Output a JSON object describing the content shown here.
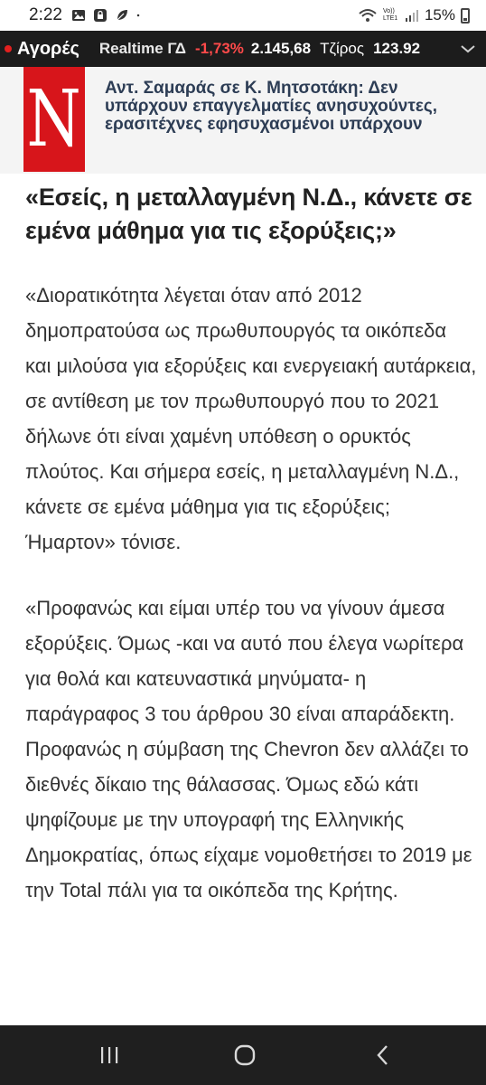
{
  "status_bar": {
    "time": "2:22",
    "network_label": "Vo)) LTE1",
    "battery": "15%"
  },
  "ticker": {
    "markets_label": "Αγορές",
    "realtime_label": "Realtime ΓΔ",
    "change": "-1,73%",
    "index_value": "2.145,68",
    "turnover_label": "Τζίρος",
    "turnover_value": "123.92"
  },
  "header": {
    "logo_letter": "N",
    "title": "Αντ. Σαμαράς σε Κ. Μητσοτάκη: Δεν υπάρχουν επαγγελματίες ανησυχούντες, ερασιτέχνες εφησυχασμένοι υπάρχουν"
  },
  "article": {
    "heading": "«Εσείς, η μεταλλαγμένη Ν.Δ., κάνετε σε εμένα μάθημα για τις εξορύξεις;»",
    "paragraph1": "«Διορατικότητα λέγεται όταν από 2012 δημοπρατούσα ως πρωθυπουργός τα οικόπεδα και μιλούσα για εξορύξεις και ενεργειακή αυτάρκεια, σε αντίθεση με τον πρωθυπουργό που το 2021 δήλωνε ότι είναι χαμένη υπόθεση ο ορυκτός πλούτος. Και σήμερα εσείς, η μεταλλαγμένη Ν.Δ., κάνετε σε εμένα μάθημα για τις εξορύξεις; Ήμαρτον» τόνισε.",
    "paragraph2": "«Προφανώς και είμαι υπέρ του να γίνουν άμεσα εξορύξεις. Όμως -και να αυτό που έλεγα νωρίτερα για θολά και κατευναστικά μηνύματα- η παράγραφος 3 του άρθρου 30 είναι απαράδεκτη. Προφανώς η σύμβαση της Chevron δεν αλλάζει το διεθνές δίκαιο της θάλασσας. Όμως εδώ κάτι ψηφίζουμε με την υπογραφή της Ελληνικής Δημοκρατίας, όπως είχαμε νομοθετήσει το 2019 με την Total πάλι για τα οικόπεδα της Κρήτης."
  },
  "colors": {
    "ticker_bg": "#1c1c1c",
    "negative": "#ff4a4a",
    "logo_red": "#d7151b",
    "header_title": "#2d3d55",
    "nav_bg": "#1f1f1f"
  }
}
